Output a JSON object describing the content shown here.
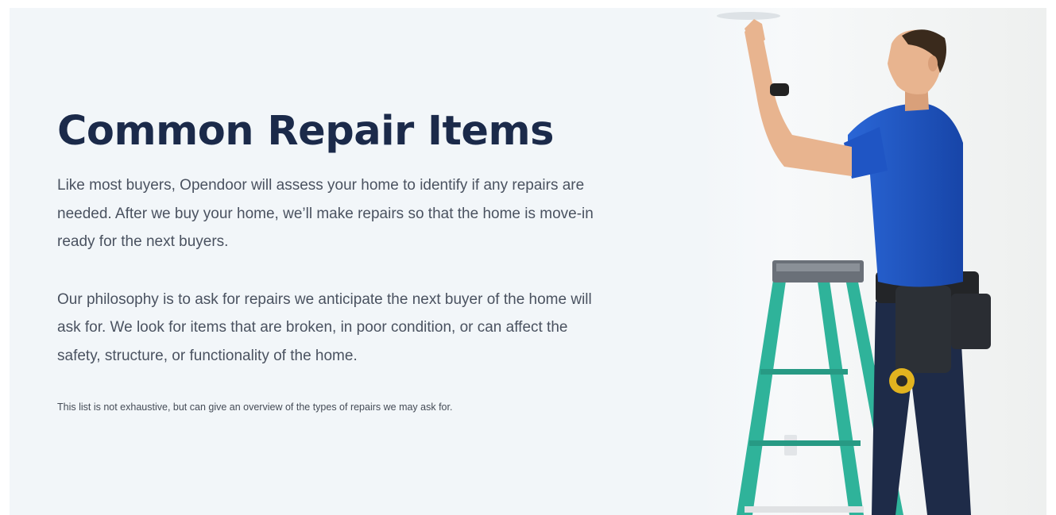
{
  "section": {
    "title": "Common Repair Items",
    "paragraph_1": "Like most buyers, Opendoor will assess your home to identify if any repairs are needed. After we buy your home, we’ll make repairs so that the home is move-in ready for the next buyers.",
    "paragraph_2": "Our philosophy is to ask for repairs we anticipate the next buyer of the home will ask for. We look for items that are broken, in poor condition, or can affect the safety, structure, or functionality of the home.",
    "note": "This list is not exhaustive, but can give an overview of the types of repairs we may ask for."
  },
  "image": {
    "subject": "repairman-on-ladder",
    "colors": {
      "shirt": "#1d56c8",
      "ladder": "#2fb39a",
      "jeans": "#1e2b48",
      "skin": "#e8b48f"
    }
  }
}
